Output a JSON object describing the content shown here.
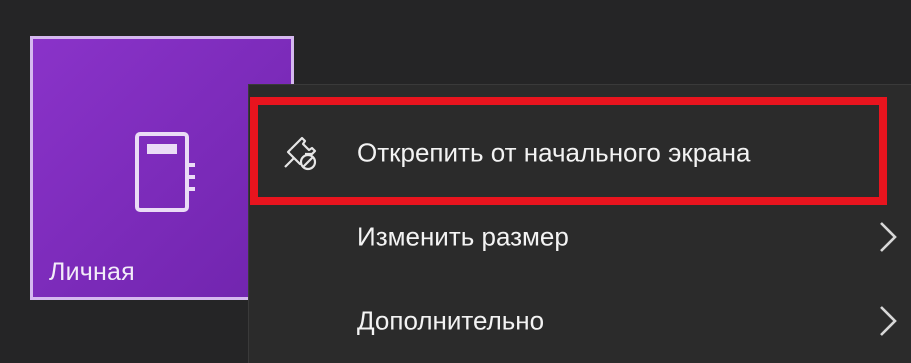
{
  "tile": {
    "label": "Личная",
    "icon": "notebook-icon",
    "color": "#7a2ab8"
  },
  "context_menu": {
    "items": [
      {
        "label": "Открепить от начального экрана",
        "icon": "unpin-icon",
        "has_submenu": false,
        "highlighted": true
      },
      {
        "label": "Изменить размер",
        "icon": "",
        "has_submenu": true,
        "highlighted": false
      },
      {
        "label": "Дополнительно",
        "icon": "",
        "has_submenu": true,
        "highlighted": false
      }
    ]
  },
  "highlight_color": "#e8141e"
}
